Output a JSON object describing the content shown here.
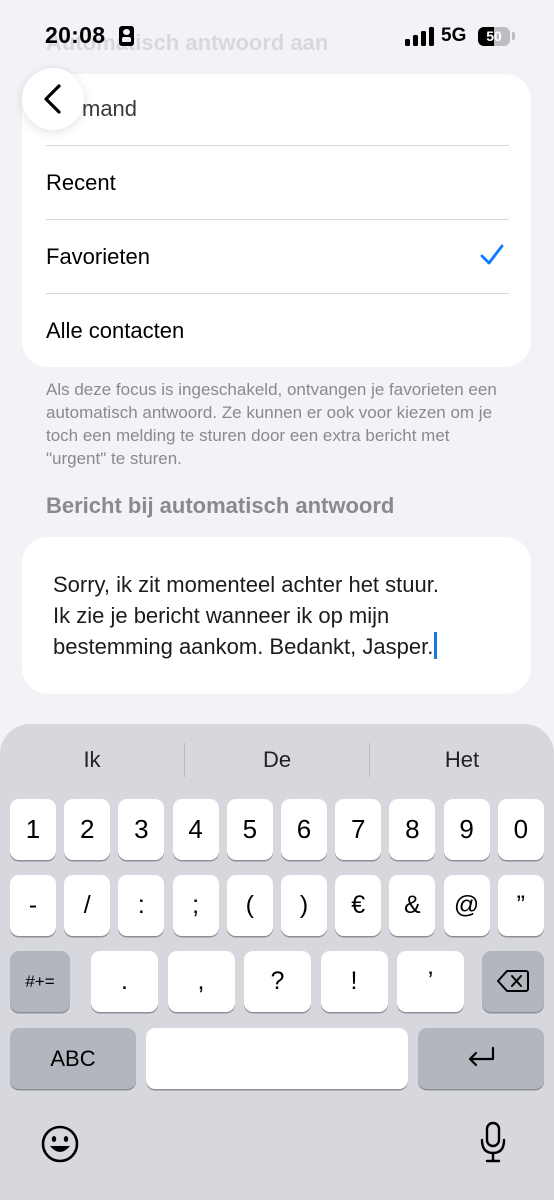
{
  "status_bar": {
    "time": "20:08",
    "network": "5G",
    "battery": "50",
    "battery_level": 0.5
  },
  "faded_title": "Automatisch antwoord aan",
  "list": {
    "partial_item": "mand",
    "items": [
      {
        "label": "Recent",
        "selected": false
      },
      {
        "label": "Favorieten",
        "selected": true
      },
      {
        "label": "Alle contacten",
        "selected": false
      }
    ]
  },
  "footnote": "Als deze focus is ingeschakeld, ontvangen je favorieten een automatisch antwoord. Ze kunnen er ook voor kiezen om je toch een melding te sturen door een extra bericht met \"urgent\" te sturen.",
  "message_section": {
    "header": "Bericht bij automatisch antwoord",
    "lines": [
      "Sorry, ik zit momenteel achter het stuur.",
      "Ik zie je bericht wanneer ik op mijn",
      "bestemming aankom. Bedankt, Jasper."
    ]
  },
  "keyboard": {
    "suggestions": [
      "Ik",
      "De",
      "Het"
    ],
    "row1": [
      "1",
      "2",
      "3",
      "4",
      "5",
      "6",
      "7",
      "8",
      "9",
      "0"
    ],
    "row2": [
      "-",
      "/",
      ":",
      ";",
      "(",
      ")",
      "€",
      "&",
      "@",
      "”"
    ],
    "row3": {
      "toggle": "#+=",
      "keys": [
        ".",
        ",",
        "?",
        "!",
        "’"
      ]
    },
    "row4": {
      "abc": "ABC"
    }
  },
  "colors": {
    "accent": "#0a7aff",
    "caret": "#1a73e8"
  },
  "icons": [
    "chevron-left-icon",
    "checkmark-icon",
    "delete-icon",
    "return-icon",
    "emoji-icon",
    "microphone-icon"
  ]
}
